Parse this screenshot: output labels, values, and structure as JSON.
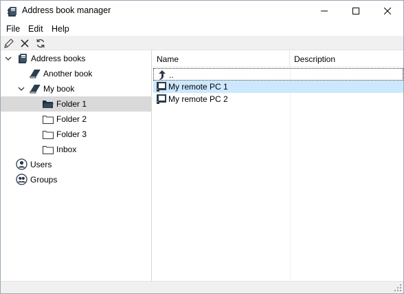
{
  "window": {
    "title": "Address book manager",
    "icon": "address-book-icon"
  },
  "menu": {
    "items": [
      {
        "label": "File"
      },
      {
        "label": "Edit"
      },
      {
        "label": "Help"
      }
    ]
  },
  "toolbar": {
    "buttons": [
      {
        "icon": "pencil-icon"
      },
      {
        "icon": "delete-x-icon"
      },
      {
        "icon": "refresh-icon"
      }
    ]
  },
  "tree": {
    "root": {
      "label": "Address books",
      "icon": "address-book-icon",
      "expanded": true
    },
    "another_book": {
      "label": "Another book",
      "icon": "book-icon"
    },
    "my_book": {
      "label": "My book",
      "icon": "book-icon",
      "expanded": true
    },
    "folders": [
      {
        "label": "Folder 1",
        "selected": true
      },
      {
        "label": "Folder 2"
      },
      {
        "label": "Folder 3"
      },
      {
        "label": "Inbox"
      }
    ],
    "users": {
      "label": "Users",
      "icon": "user-icon"
    },
    "groups": {
      "label": "Groups",
      "icon": "group-icon"
    }
  },
  "list": {
    "columns": [
      {
        "label": "Name"
      },
      {
        "label": "Description"
      }
    ],
    "rows": [
      {
        "name": "..",
        "description": "",
        "icon": "up-arrow-icon",
        "focused": true
      },
      {
        "name": "My remote PC 1",
        "description": "",
        "icon": "computer-icon",
        "selected": true
      },
      {
        "name": "My remote PC 2",
        "description": "",
        "icon": "computer-icon"
      }
    ]
  },
  "colors": {
    "selection_tree": "#d9d9d9",
    "selection_list": "#cce8ff",
    "toolbar_bg": "#f0f0f0"
  }
}
